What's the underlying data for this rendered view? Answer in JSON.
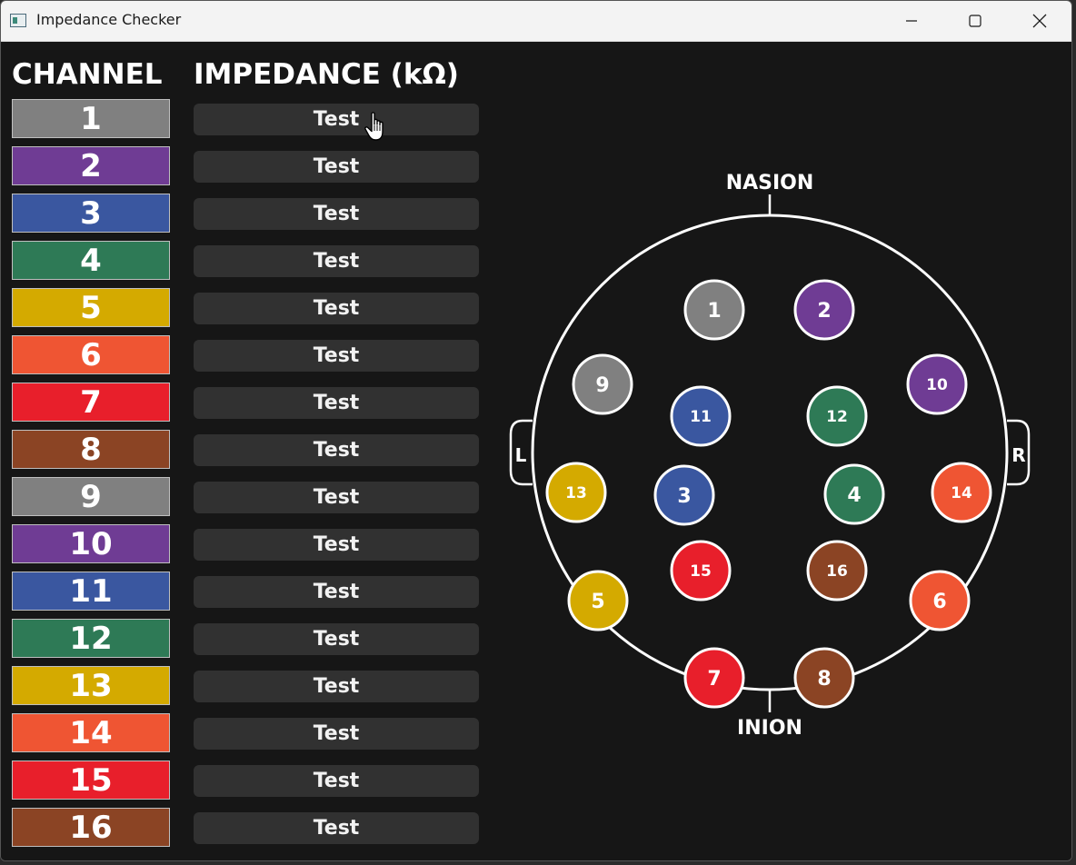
{
  "window": {
    "title": "Impedance Checker"
  },
  "headers": {
    "channel": "CHANNEL",
    "impedance": "IMPEDANCE (kΩ)"
  },
  "channels": [
    {
      "label": "1",
      "color": "#808080",
      "button": "Test"
    },
    {
      "label": "2",
      "color": "#6f3c94",
      "button": "Test"
    },
    {
      "label": "3",
      "color": "#3a57a0",
      "button": "Test"
    },
    {
      "label": "4",
      "color": "#2e7a56",
      "button": "Test"
    },
    {
      "label": "5",
      "color": "#d4aa00",
      "button": "Test"
    },
    {
      "label": "6",
      "color": "#ef5533",
      "button": "Test"
    },
    {
      "label": "7",
      "color": "#e81f2b",
      "button": "Test"
    },
    {
      "label": "8",
      "color": "#8b4424",
      "button": "Test"
    },
    {
      "label": "9",
      "color": "#808080",
      "button": "Test"
    },
    {
      "label": "10",
      "color": "#6f3c94",
      "button": "Test"
    },
    {
      "label": "11",
      "color": "#3a57a0",
      "button": "Test"
    },
    {
      "label": "12",
      "color": "#2e7a56",
      "button": "Test"
    },
    {
      "label": "13",
      "color": "#d4aa00",
      "button": "Test"
    },
    {
      "label": "14",
      "color": "#ef5533",
      "button": "Test"
    },
    {
      "label": "15",
      "color": "#e81f2b",
      "button": "Test"
    },
    {
      "label": "16",
      "color": "#8b4424",
      "button": "Test"
    }
  ],
  "headmap": {
    "top_label": "NASION",
    "bottom_label": "INION",
    "left_label": "L",
    "right_label": "R"
  },
  "icons": {
    "app": "app-icon",
    "minimize": "minimize-icon",
    "maximize": "maximize-icon",
    "close": "close-icon",
    "cursor": "hand-pointer-icon"
  }
}
